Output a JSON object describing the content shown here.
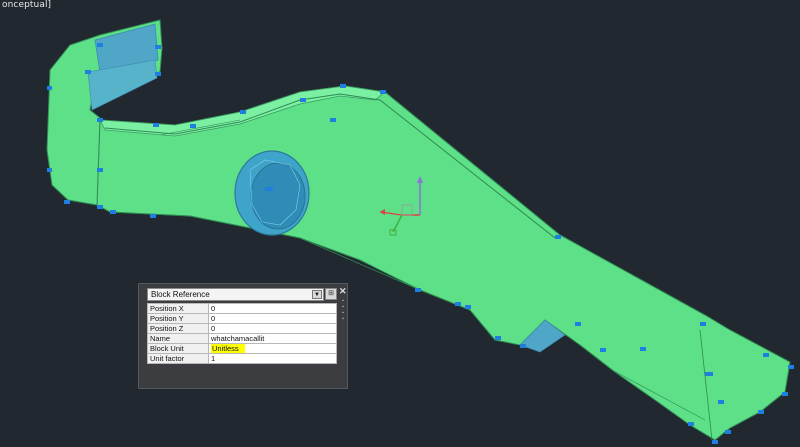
{
  "viewport": {
    "label": "onceptual]"
  },
  "properties_palette": {
    "object_type": "Block Reference",
    "close_icon": "close-x-icon",
    "quick_select_icon": "quick-select-icon",
    "rows": [
      {
        "key": "Position X",
        "value": "0"
      },
      {
        "key": "Position Y",
        "value": "0"
      },
      {
        "key": "Position Z",
        "value": "0"
      },
      {
        "key": "Name",
        "value": "whatchamacallit"
      },
      {
        "key": "Block Unit",
        "value": "Unitless"
      },
      {
        "key": "Unit factor",
        "value": "1"
      }
    ],
    "highlight_color": "#ffff00"
  },
  "colors": {
    "background": "#212830",
    "model_fill": "#5ee089",
    "grip": "#1e7fe0"
  }
}
